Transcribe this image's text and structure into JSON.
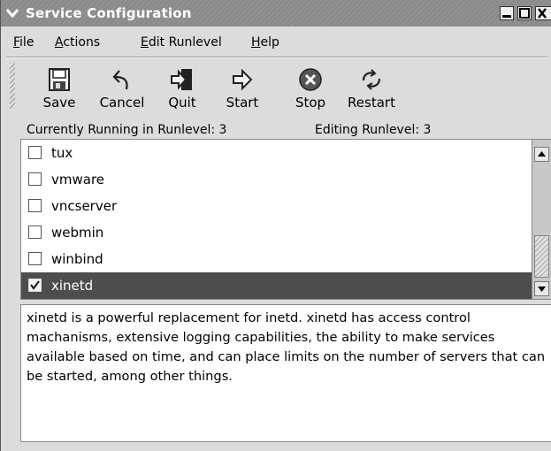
{
  "window": {
    "title": "Service Configuration"
  },
  "menu": {
    "items": [
      {
        "label": "File",
        "mnemonic": "F",
        "rest": "ile"
      },
      {
        "label": "Actions",
        "mnemonic": "A",
        "rest": "ctions"
      },
      {
        "label": "Edit Runlevel",
        "mnemonic": "E",
        "rest": "dit Runlevel"
      },
      {
        "label": "Help",
        "mnemonic": "H",
        "rest": "elp"
      }
    ]
  },
  "toolbar": {
    "buttons": [
      {
        "label": "Save",
        "icon": "floppy-disk-icon"
      },
      {
        "label": "Cancel",
        "icon": "undo-arrow-icon"
      },
      {
        "label": "Quit",
        "icon": "exit-door-icon"
      },
      {
        "label": "Start",
        "icon": "right-arrow-icon"
      },
      {
        "label": "Stop",
        "icon": "stop-circle-icon"
      },
      {
        "label": "Restart",
        "icon": "restart-arrows-icon"
      }
    ]
  },
  "status": {
    "current": "Currently Running in Runlevel: 3",
    "editing": "Editing Runlevel: 3"
  },
  "services": [
    {
      "name": "tux",
      "checked": false,
      "selected": false
    },
    {
      "name": "vmware",
      "checked": false,
      "selected": false
    },
    {
      "name": "vncserver",
      "checked": false,
      "selected": false
    },
    {
      "name": "webmin",
      "checked": false,
      "selected": false
    },
    {
      "name": "winbind",
      "checked": false,
      "selected": false
    },
    {
      "name": "xinetd",
      "checked": true,
      "selected": true
    }
  ],
  "description": {
    "text": "xinetd is a powerful replacement for inetd. xinetd has access control machanisms, extensive logging capabilities, the ability to make services available based on time, and can place limits on the number of servers that can be started, among other things."
  },
  "colors": {
    "titlebar": "#8a8a8a",
    "selected_row": "#4d4d4d",
    "window_bg": "#dcdcdc"
  }
}
